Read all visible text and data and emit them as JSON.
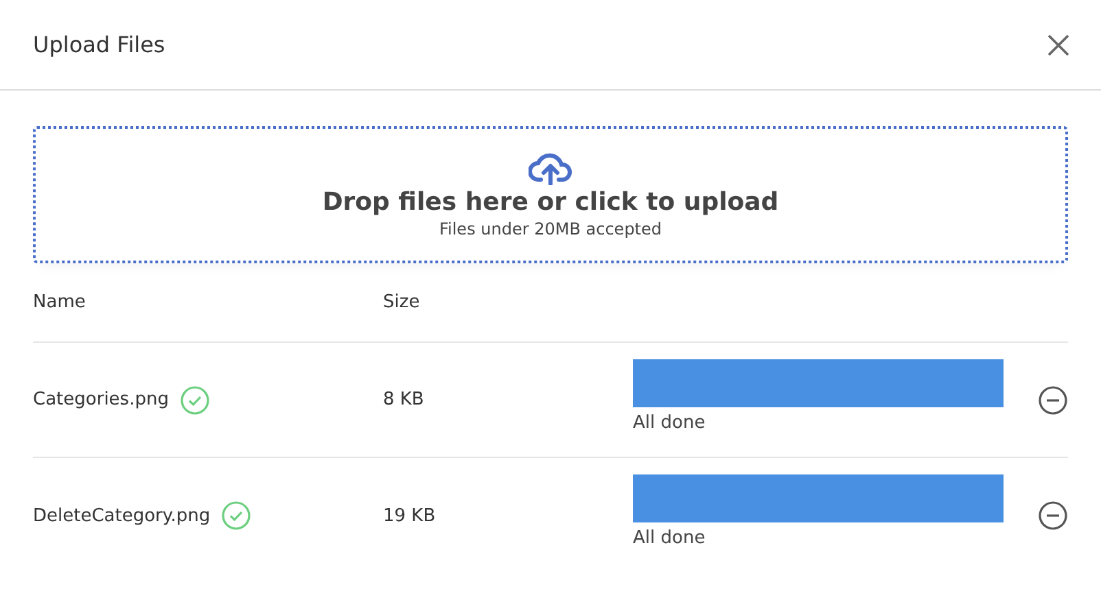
{
  "dialog": {
    "title": "Upload Files"
  },
  "dropzone": {
    "heading": "Drop files here or click to upload",
    "hint": "Files under 20MB accepted"
  },
  "table": {
    "columns": [
      "Name",
      "Size"
    ],
    "rows": [
      {
        "name": "Categories.png",
        "complete": true,
        "size": "8 KB",
        "level": 1,
        "status": "All done"
      },
      {
        "name": "DeleteCategory.png",
        "complete": true,
        "size": "19 KB",
        "level": 1,
        "status": "All done"
      }
    ]
  }
}
